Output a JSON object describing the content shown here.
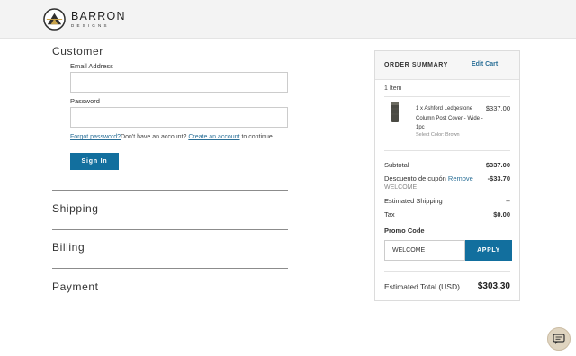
{
  "brand": {
    "name": "BARRON",
    "tagline": "DESIGNS"
  },
  "checkout": {
    "customer": {
      "title": "Customer",
      "email_label": "Email Address",
      "email_value": "",
      "password_label": "Password",
      "password_value": "",
      "forgot_password": "Forgot password?",
      "no_account_text": "Don't have an account?",
      "create_account": "Create an account",
      "continue_text": "to continue.",
      "signin_label": "Sign In"
    },
    "shipping_title": "Shipping",
    "billing_title": "Billing",
    "payment_title": "Payment"
  },
  "summary": {
    "title": "ORDER SUMMARY",
    "edit_cart": "Edit Cart",
    "item_count": "1 Item",
    "item": {
      "description": "1 x Ashford Ledgestone Column Post Cover - Wide - 1pc",
      "option": "Select Color: Brown",
      "price": "$337.00"
    },
    "subtotal_label": "Subtotal",
    "subtotal_value": "$337.00",
    "discount_label": "Descuento de cupón",
    "discount_remove": "Remove",
    "discount_code": "WELCOME",
    "discount_value": "-$33.70",
    "shipping_label": "Estimated Shipping",
    "shipping_value": "--",
    "tax_label": "Tax",
    "tax_value": "$0.00",
    "promo_label": "Promo Code",
    "promo_value": "WELCOME",
    "apply_label": "APPLY",
    "total_label": "Estimated Total (USD)",
    "total_value": "$303.30"
  },
  "icons": {
    "logo": "barron-logo-icon",
    "chat": "chat-bubble-icon",
    "thumbnail": "column-post-cover-image"
  },
  "colors": {
    "accent": "#126f9e",
    "link": "#2a6f97",
    "header_bg": "#f3f3f3"
  }
}
